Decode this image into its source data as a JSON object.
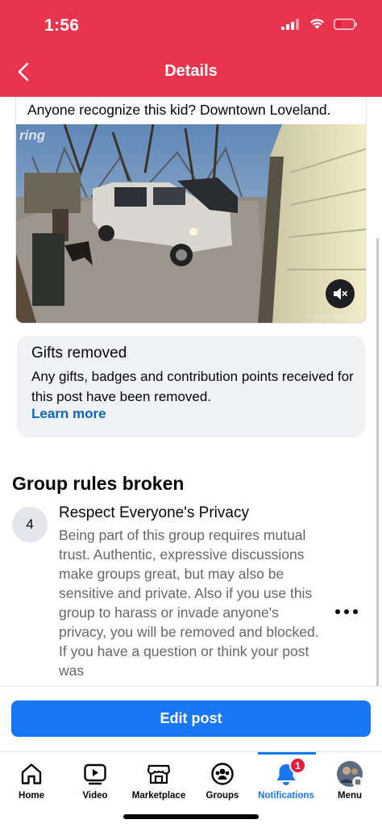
{
  "status_bar": {
    "time": "1:56",
    "icons": [
      "signal-icon",
      "wifi-icon",
      "battery-low-icon"
    ]
  },
  "header": {
    "title": "Details",
    "back_icon": "chevron-left-icon",
    "background": "#e8344c"
  },
  "post": {
    "caption": "Anyone recognize this kid? Downtown Loveland.",
    "video_watermark": "ring",
    "video_timestamp": "01/13/2023 05:02:31 PST",
    "mute_icon": "speaker-muted-icon"
  },
  "gifts_notice": {
    "title": "Gifts removed",
    "text": "Any gifts, badges and contribution points received for this post have been removed.",
    "link": "Learn more"
  },
  "rules": {
    "heading": "Group rules broken",
    "items": [
      {
        "number": "4",
        "title": "Respect Everyone's Privacy",
        "text": "Being part of this group requires mutual trust. Authentic, expressive discussions make groups great, but may also be sensitive and private. Also if you use this group to harass or invade anyone's privacy, you will be removed and blocked. If you have a question or think your post was"
      }
    ],
    "more_icon": "more-horizontal-icon"
  },
  "edit_button": {
    "label": "Edit post",
    "color": "#1877f2"
  },
  "tabbar": {
    "active_color": "#1877f2",
    "tabs": [
      {
        "label": "Home",
        "icon": "home-icon"
      },
      {
        "label": "Video",
        "icon": "video-icon"
      },
      {
        "label": "Marketplace",
        "icon": "marketplace-icon"
      },
      {
        "label": "Groups",
        "icon": "groups-icon"
      },
      {
        "label": "Notifications",
        "icon": "bell-icon",
        "badge": "1",
        "active": true
      },
      {
        "label": "Menu",
        "icon": "profile-avatar-icon"
      }
    ]
  }
}
